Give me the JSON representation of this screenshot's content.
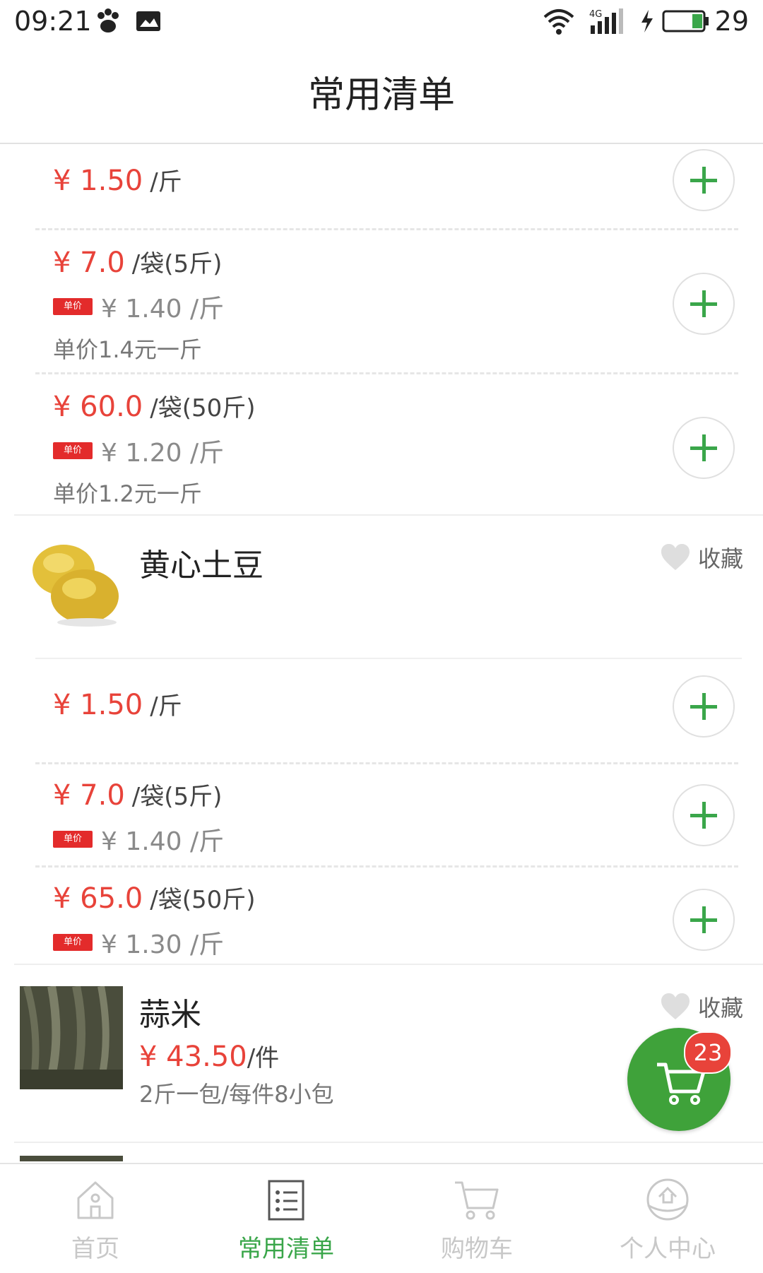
{
  "status_bar": {
    "time": "09:21",
    "battery": "29"
  },
  "header": {
    "title": "常用清单"
  },
  "colors": {
    "accent": "#3aa64a",
    "price": "#e8433a",
    "badge": "#e8433a"
  },
  "groups": [
    {
      "name": null,
      "options": [
        {
          "price": "¥ 1.50",
          "unit": "/斤"
        },
        {
          "price": "¥ 7.0",
          "unit": "/袋(5斤)",
          "tag": "单价",
          "unit_price": "¥ 1.40 /斤",
          "note": "单价1.4元一斤"
        },
        {
          "price": "¥ 60.0",
          "unit": "/袋(50斤)",
          "tag": "单价",
          "unit_price": "¥ 1.20 /斤",
          "note": "单价1.2元一斤"
        }
      ]
    },
    {
      "name": "黄心土豆",
      "favorite_label": "收藏",
      "options": [
        {
          "price": "¥ 1.50",
          "unit": "/斤"
        },
        {
          "price": "¥ 7.0",
          "unit": "/袋(5斤)",
          "tag": "单价",
          "unit_price": "¥ 1.40 /斤"
        },
        {
          "price": "¥ 65.0",
          "unit": "/袋(50斤)",
          "tag": "单价",
          "unit_price": "¥ 1.30 /斤"
        }
      ]
    },
    {
      "name": "蒜米",
      "favorite_label": "收藏",
      "price": "¥ 43.50",
      "unit": "/件",
      "desc": "2斤一包/每件8小包"
    }
  ],
  "cart": {
    "count": "23"
  },
  "tabbar": {
    "tabs": [
      {
        "label": "首页",
        "icon": "home-icon"
      },
      {
        "label": "常用清单",
        "icon": "list-icon"
      },
      {
        "label": "购物车",
        "icon": "cart-icon"
      },
      {
        "label": "个人中心",
        "icon": "profile-icon"
      }
    ],
    "active": 1
  }
}
